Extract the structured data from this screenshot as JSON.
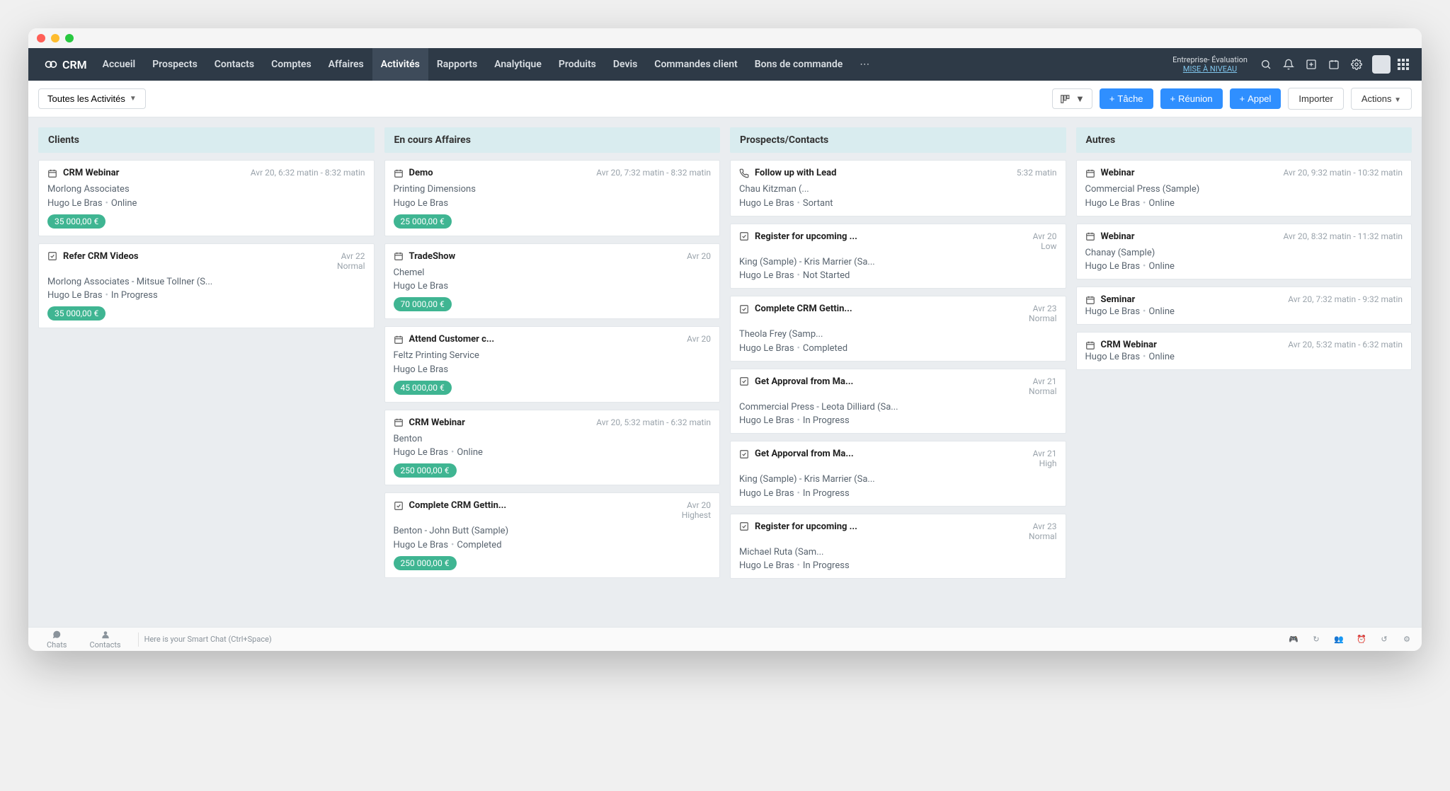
{
  "brand": "CRM",
  "nav": [
    "Accueil",
    "Prospects",
    "Contacts",
    "Comptes",
    "Affaires",
    "Activités",
    "Rapports",
    "Analytique",
    "Produits",
    "Devis",
    "Commandes client",
    "Bons de commande"
  ],
  "nav_active_index": 5,
  "upgrade": {
    "line1": "Entreprise- Évaluation",
    "link": "MISE À NIVEAU"
  },
  "toolbar": {
    "filter": "Toutes les Activités",
    "task": "Tâche",
    "meeting": "Réunion",
    "call": "Appel",
    "import": "Importer",
    "actions": "Actions"
  },
  "columns": [
    {
      "title": "Clients",
      "cards": [
        {
          "icon": "cal",
          "title": "CRM Webinar",
          "meta": "Avr 20, 6:32 matin - 8:32 matin",
          "sub": "Morlong Associates",
          "line": "Hugo Le Bras",
          "line2": "Online",
          "badge": "35 000,00 €"
        },
        {
          "icon": "check",
          "title": "Refer CRM Videos",
          "meta": "Avr 22",
          "meta2": "Normal",
          "sub": "Morlong Associates - Mitsue Tollner (S...",
          "line": "Hugo Le Bras",
          "line2": "In Progress",
          "badge": "35 000,00 €"
        }
      ]
    },
    {
      "title": "En cours Affaires",
      "cards": [
        {
          "icon": "cal",
          "title": "Demo",
          "meta": "Avr 20, 7:32 matin - 8:32 matin",
          "sub": "Printing Dimensions",
          "line": "Hugo Le Bras",
          "badge": "25 000,00 €"
        },
        {
          "icon": "cal",
          "title": "TradeShow",
          "meta": "Avr 20",
          "sub": "Chemel",
          "line": "Hugo Le Bras",
          "badge": "70 000,00 €"
        },
        {
          "icon": "cal",
          "title": "Attend Customer c...",
          "meta": "Avr 20",
          "sub": "Feltz Printing Service",
          "line": "Hugo Le Bras",
          "badge": "45 000,00 €"
        },
        {
          "icon": "cal",
          "title": "CRM Webinar",
          "meta": "Avr 20, 5:32 matin - 6:32 matin",
          "sub": "Benton",
          "line": "Hugo Le Bras",
          "line2": "Online",
          "badge": "250 000,00 €"
        },
        {
          "icon": "check",
          "title": "Complete CRM Gettin...",
          "meta": "Avr 20",
          "meta2": "Highest",
          "sub": "Benton - John Butt (Sample)",
          "line": "Hugo Le Bras",
          "line2": "Completed",
          "badge": "250 000,00 €"
        }
      ]
    },
    {
      "title": "Prospects/Contacts",
      "cards": [
        {
          "icon": "phone",
          "title": "Follow up with Lead",
          "meta": "5:32 matin",
          "sub": "Chau Kitzman (...",
          "line": "Hugo Le Bras",
          "line2": "Sortant"
        },
        {
          "icon": "check",
          "title": "Register for upcoming ...",
          "meta": "Avr 20",
          "meta2": "Low",
          "sub": "King (Sample) - Kris Marrier (Sa...",
          "line": "Hugo Le Bras",
          "line2": "Not Started"
        },
        {
          "icon": "check",
          "title": "Complete CRM Gettin...",
          "meta": "Avr 23",
          "meta2": "Normal",
          "sub": "Theola Frey (Samp...",
          "line": "Hugo Le Bras",
          "line2": "Completed"
        },
        {
          "icon": "check",
          "title": "Get Approval from Ma...",
          "meta": "Avr 21",
          "meta2": "Normal",
          "sub": "Commercial Press - Leota Dilliard (Sa...",
          "line": "Hugo Le Bras",
          "line2": "In Progress"
        },
        {
          "icon": "check",
          "title": "Get Apporval from Ma...",
          "meta": "Avr 21",
          "meta2": "High",
          "sub": "King (Sample) - Kris Marrier (Sa...",
          "line": "Hugo Le Bras",
          "line2": "In Progress"
        },
        {
          "icon": "check",
          "title": "Register for upcoming ...",
          "meta": "Avr 23",
          "meta2": "Normal",
          "sub": "Michael Ruta (Sam...",
          "line": "Hugo Le Bras",
          "line2": "In Progress"
        }
      ]
    },
    {
      "title": "Autres",
      "cards": [
        {
          "icon": "cal",
          "title": "Webinar",
          "meta": "Avr 20, 9:32 matin - 10:32 matin",
          "sub": "Commercial Press (Sample)",
          "line": "Hugo Le Bras",
          "line2": "Online"
        },
        {
          "icon": "cal",
          "title": "Webinar",
          "meta": "Avr 20, 8:32 matin - 11:32 matin",
          "sub": "Chanay (Sample)",
          "line": "Hugo Le Bras",
          "line2": "Online"
        },
        {
          "icon": "cal",
          "title": "Seminar",
          "meta": "Avr 20, 7:32 matin - 9:32 matin",
          "line": "Hugo Le Bras",
          "line2": "Online"
        },
        {
          "icon": "cal",
          "title": "CRM Webinar",
          "meta": "Avr 20, 5:32 matin - 6:32 matin",
          "line": "Hugo Le Bras",
          "line2": "Online"
        }
      ]
    }
  ],
  "bottombar": {
    "chats": "Chats",
    "contacts": "Contacts",
    "smart": "Here is your Smart Chat (Ctrl+Space)"
  }
}
